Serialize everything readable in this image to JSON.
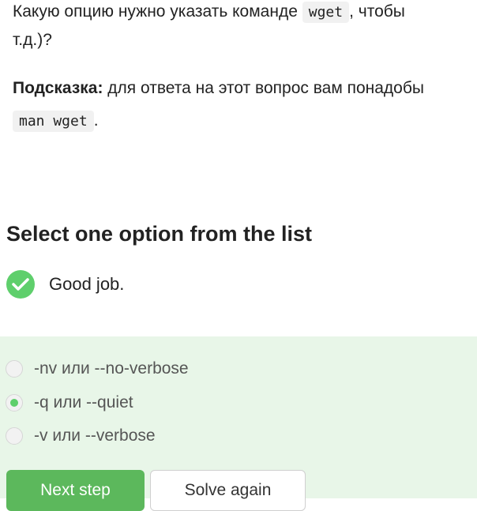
{
  "question": {
    "line1_before": "Какую опцию нужно указать команде ",
    "line1_code": "wget",
    "line1_after": ", чтобы",
    "line2": "т.д.)?"
  },
  "hint": {
    "label": "Подсказка:",
    "text": " для ответа на этот вопрос вам понадобы",
    "code": "man wget",
    "after": "."
  },
  "quiz": {
    "heading": "Select one option from the list",
    "status_icon": "checkmark-icon",
    "status_text": "Good job.",
    "options": [
      {
        "label": "-nv или --no-verbose",
        "selected": false
      },
      {
        "label": "-q или --quiet",
        "selected": true
      },
      {
        "label": "-v или --verbose",
        "selected": false
      }
    ],
    "next_label": "Next step",
    "again_label": "Solve again"
  },
  "colors": {
    "accent": "#5fcf6c",
    "panel_bg": "#e8f6e8",
    "button_green": "#5cb85c"
  }
}
